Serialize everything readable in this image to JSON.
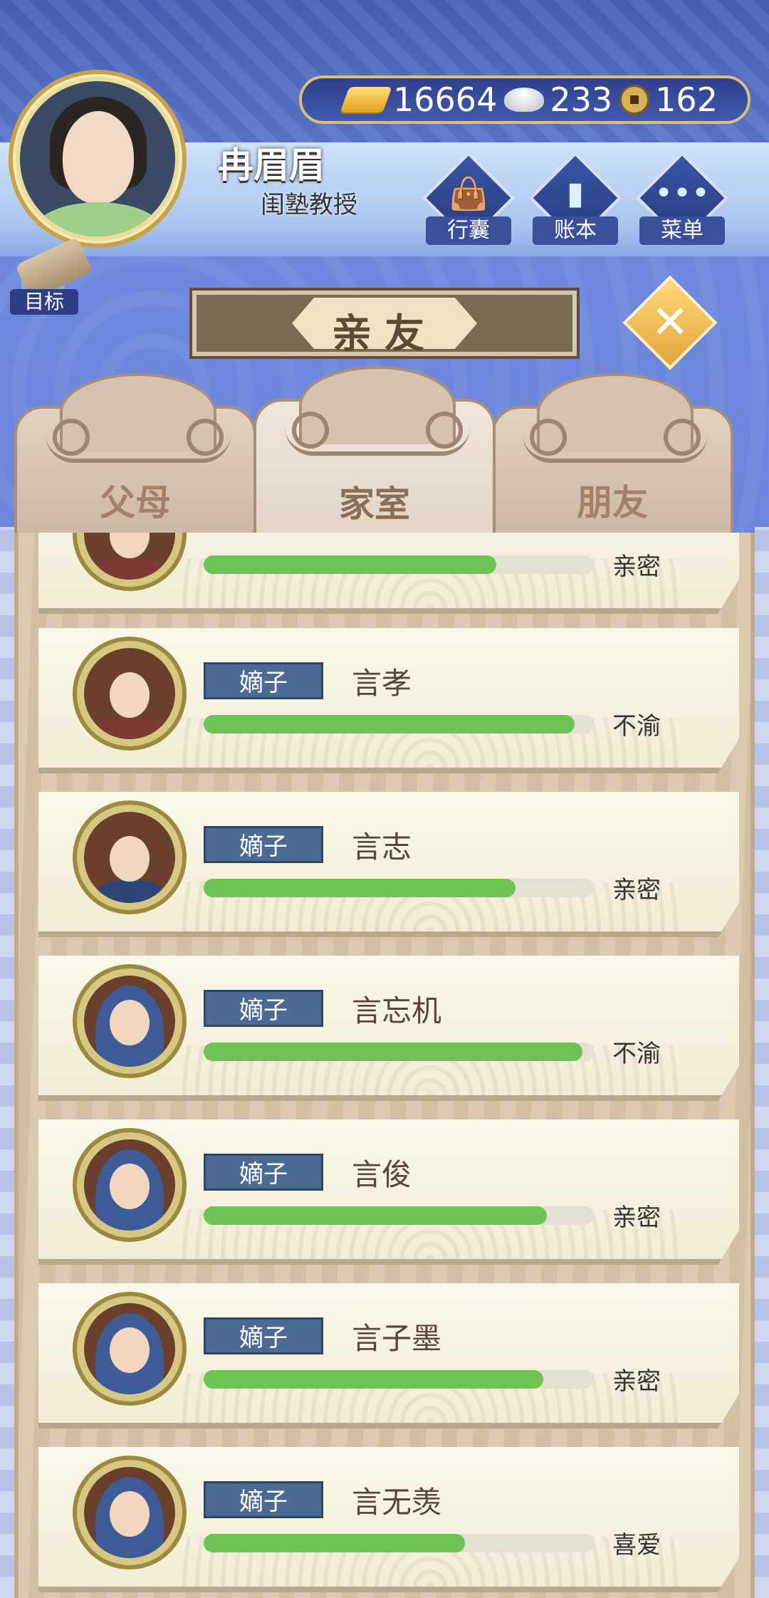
{
  "player": {
    "name": "冉眉眉",
    "title": "闺塾教授"
  },
  "currency": {
    "gold": "16664",
    "silver": "233",
    "coin": "162"
  },
  "hud": {
    "bag_label": "行囊",
    "ledger_label": "账本",
    "menu_label": "菜单",
    "menu_glyph": "•••",
    "goal_label": "目标"
  },
  "banner": {
    "title": "亲友",
    "close_glyph": "✕"
  },
  "tabs": [
    {
      "label": "父母",
      "active": false
    },
    {
      "label": "家室",
      "active": true
    },
    {
      "label": "朋友",
      "active": false
    }
  ],
  "relatives": [
    {
      "badge": "",
      "name": "",
      "affinity": 0.75,
      "status": "亲密"
    },
    {
      "badge": "嫡子",
      "name": "言孝",
      "affinity": 0.95,
      "status": "不渝"
    },
    {
      "badge": "嫡子",
      "name": "言志",
      "affinity": 0.8,
      "status": "亲密"
    },
    {
      "badge": "嫡子",
      "name": "言忘机",
      "affinity": 0.97,
      "status": "不渝"
    },
    {
      "badge": "嫡子",
      "name": "言俊",
      "affinity": 0.88,
      "status": "亲密"
    },
    {
      "badge": "嫡子",
      "name": "言子墨",
      "affinity": 0.87,
      "status": "亲密"
    },
    {
      "badge": "嫡子",
      "name": "言无羡",
      "affinity": 0.67,
      "status": "喜爱"
    }
  ],
  "colors": {
    "affinity_bar": "#6fc354",
    "badge_bg": "#4d6a94",
    "currency_border": "#d7c07a"
  }
}
